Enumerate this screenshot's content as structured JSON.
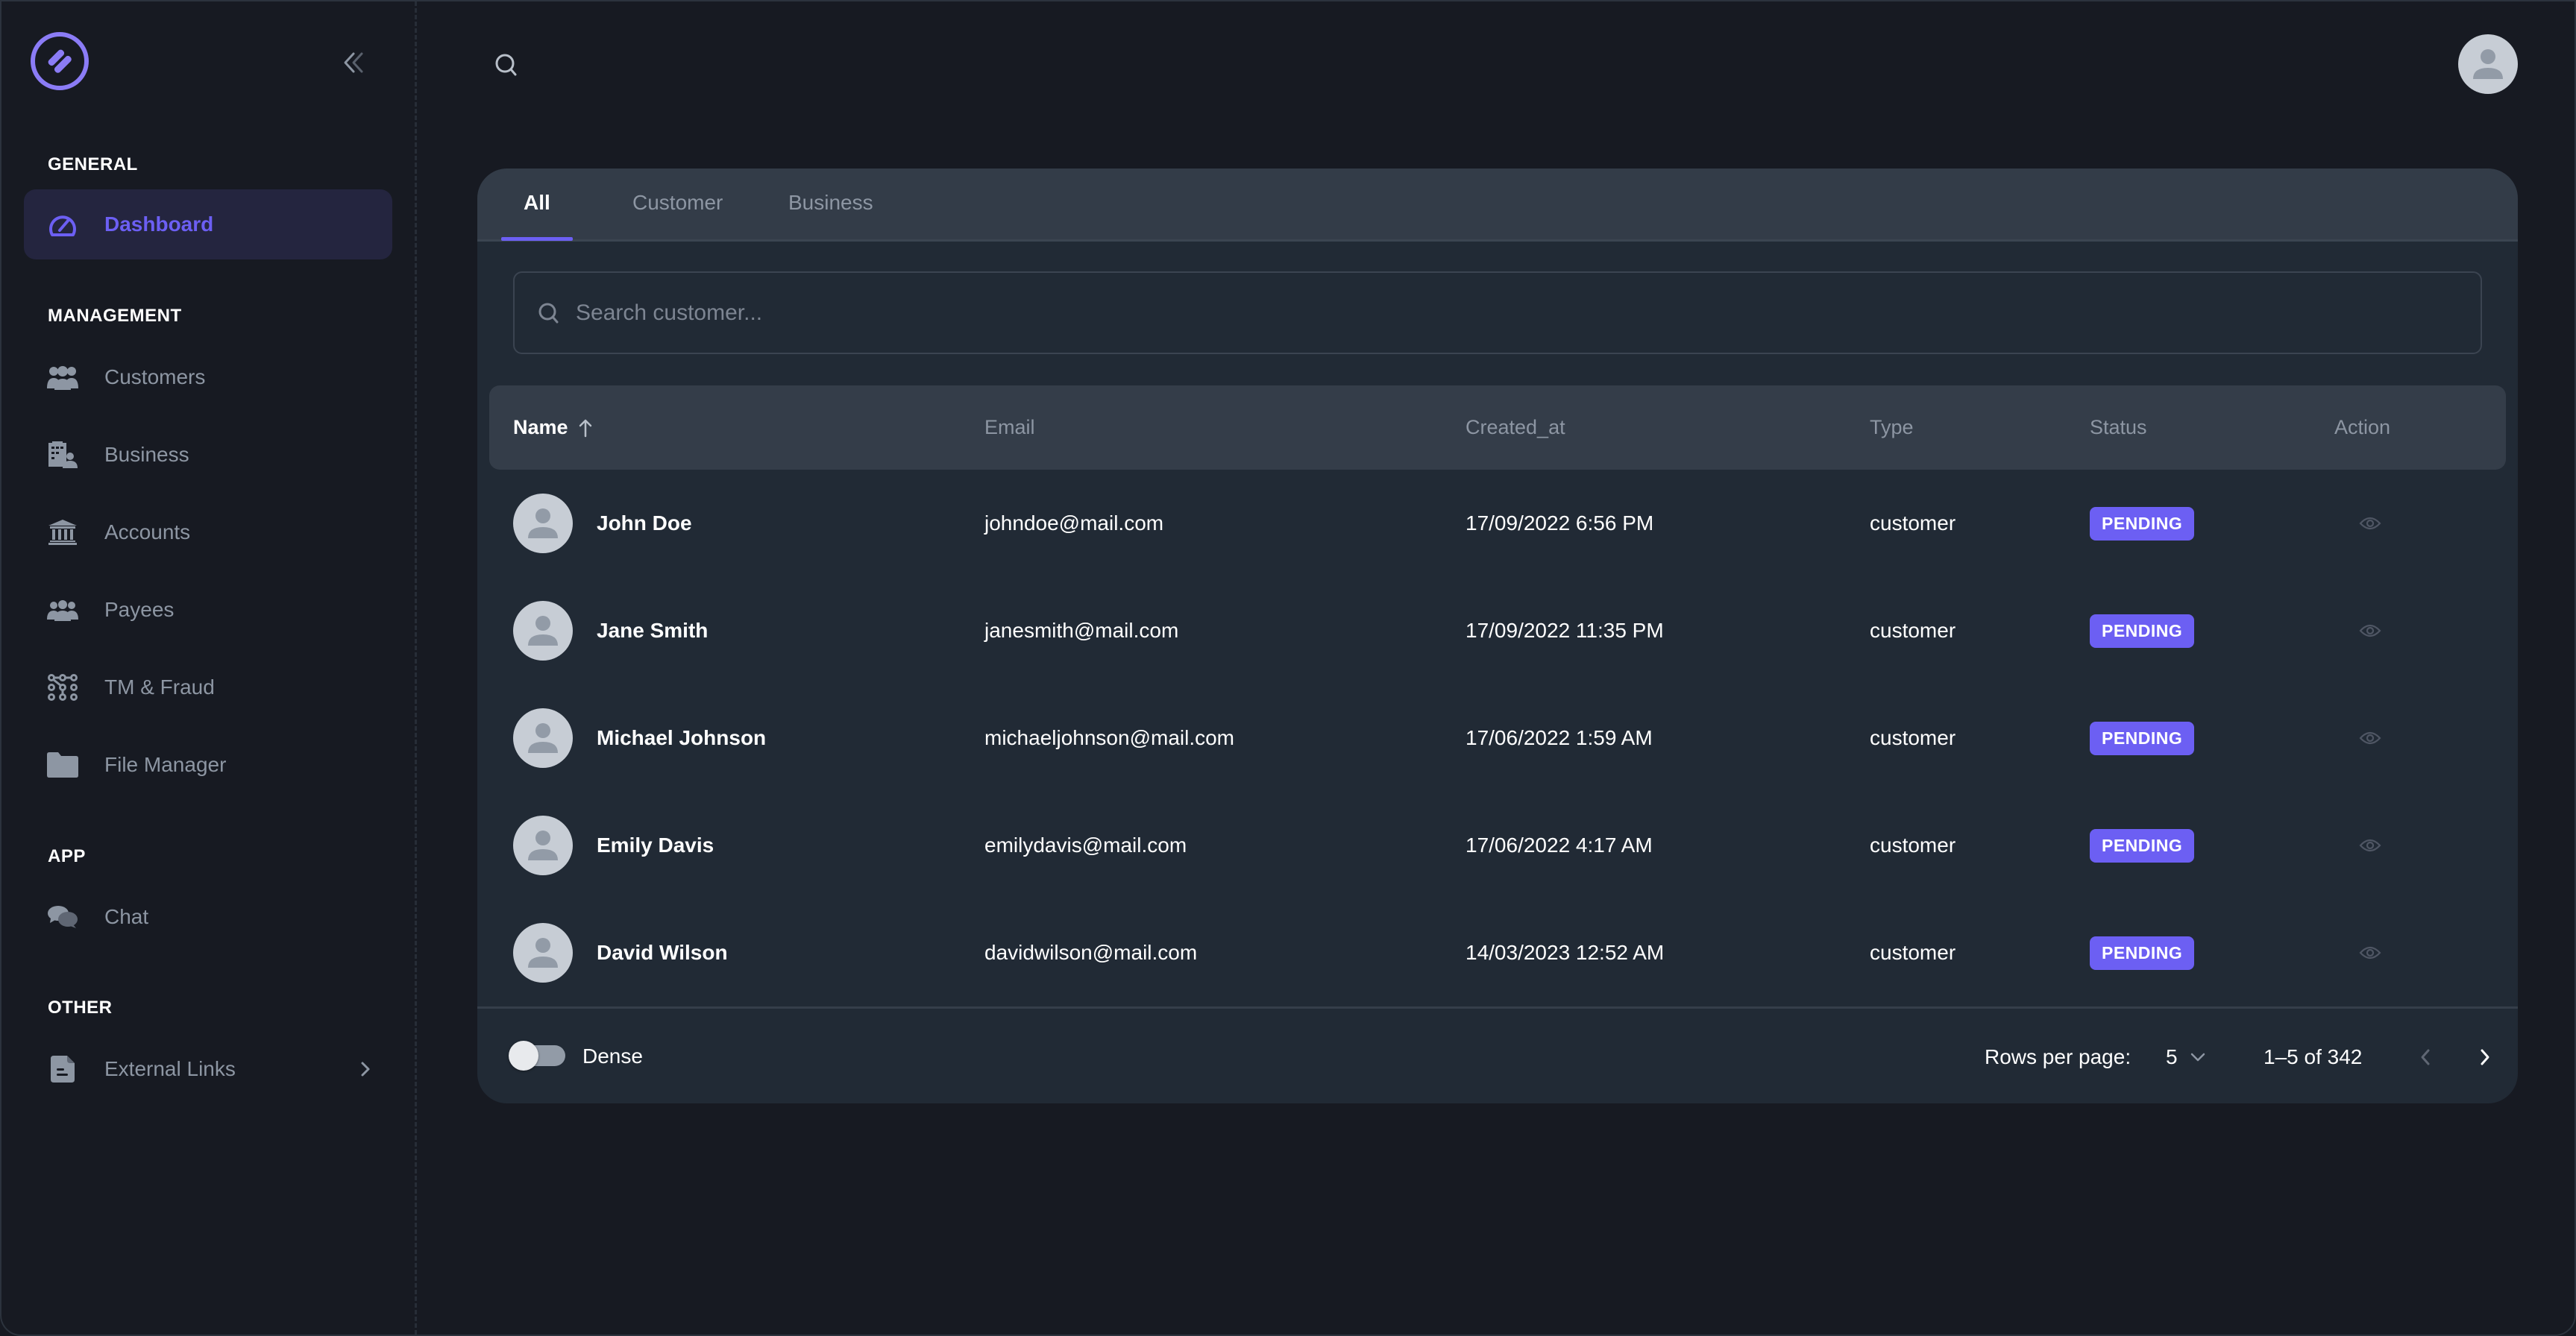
{
  "colors": {
    "accent": "#6c5ff3",
    "background": "#171a22",
    "card": "#212a35",
    "card_header": "#333c48",
    "muted_text": "#8d96a3",
    "badge_pending": "#6c5ff3"
  },
  "sidebar": {
    "logo_icon": "brand-logo-icon",
    "collapse_icon": "chevrons-left-icon",
    "sections": [
      {
        "title": "GENERAL",
        "items": [
          {
            "label": "Dashboard",
            "icon": "speedometer-icon",
            "active": true
          }
        ]
      },
      {
        "title": "MANAGEMENT",
        "items": [
          {
            "label": "Customers",
            "icon": "users-group-icon"
          },
          {
            "label": "Business",
            "icon": "building-users-icon"
          },
          {
            "label": "Accounts",
            "icon": "bank-icon"
          },
          {
            "label": "Payees",
            "icon": "people-icon"
          },
          {
            "label": "TM & Fraud",
            "icon": "network-nodes-icon"
          },
          {
            "label": "File Manager",
            "icon": "folder-icon"
          }
        ]
      },
      {
        "title": "APP",
        "items": [
          {
            "label": "Chat",
            "icon": "chat-bubbles-icon"
          }
        ]
      },
      {
        "title": "OTHER",
        "items": [
          {
            "label": "External Links",
            "icon": "document-icon",
            "has_submenu": true
          }
        ]
      }
    ]
  },
  "header": {
    "search_icon": "search-icon",
    "avatar_icon": "user-avatar-icon"
  },
  "tabs": [
    {
      "label": "All",
      "active": true
    },
    {
      "label": "Customer"
    },
    {
      "label": "Business"
    }
  ],
  "search": {
    "placeholder": "Search customer...",
    "value": ""
  },
  "table": {
    "columns": [
      {
        "label": "Name",
        "sorted": "asc"
      },
      {
        "label": "Email"
      },
      {
        "label": "Created_at"
      },
      {
        "label": "Type"
      },
      {
        "label": "Status"
      },
      {
        "label": "Action"
      }
    ],
    "rows": [
      {
        "name": "John Doe",
        "email": "johndoe@mail.com",
        "created_at": "17/09/2022 6:56 PM",
        "type": "customer",
        "status": "PENDING",
        "action": "view"
      },
      {
        "name": "Jane Smith",
        "email": "janesmith@mail.com",
        "created_at": "17/09/2022 11:35 PM",
        "type": "customer",
        "status": "PENDING",
        "action": "view"
      },
      {
        "name": "Michael Johnson",
        "email": "michaeljohnson@mail.com",
        "created_at": "17/06/2022 1:59 AM",
        "type": "customer",
        "status": "PENDING",
        "action": "view"
      },
      {
        "name": "Emily Davis",
        "email": "emilydavis@mail.com",
        "created_at": "17/06/2022 4:17 AM",
        "type": "customer",
        "status": "PENDING",
        "action": "view"
      },
      {
        "name": "David Wilson",
        "email": "davidwilson@mail.com",
        "created_at": "14/03/2023 12:52 AM",
        "type": "customer",
        "status": "PENDING",
        "action": "view"
      }
    ]
  },
  "footer": {
    "dense_label": "Dense",
    "dense_enabled": false,
    "rows_per_page_label": "Rows per page:",
    "rows_per_page_value": "5",
    "range_text": "1–5 of 342",
    "prev_enabled": false,
    "next_enabled": true
  }
}
